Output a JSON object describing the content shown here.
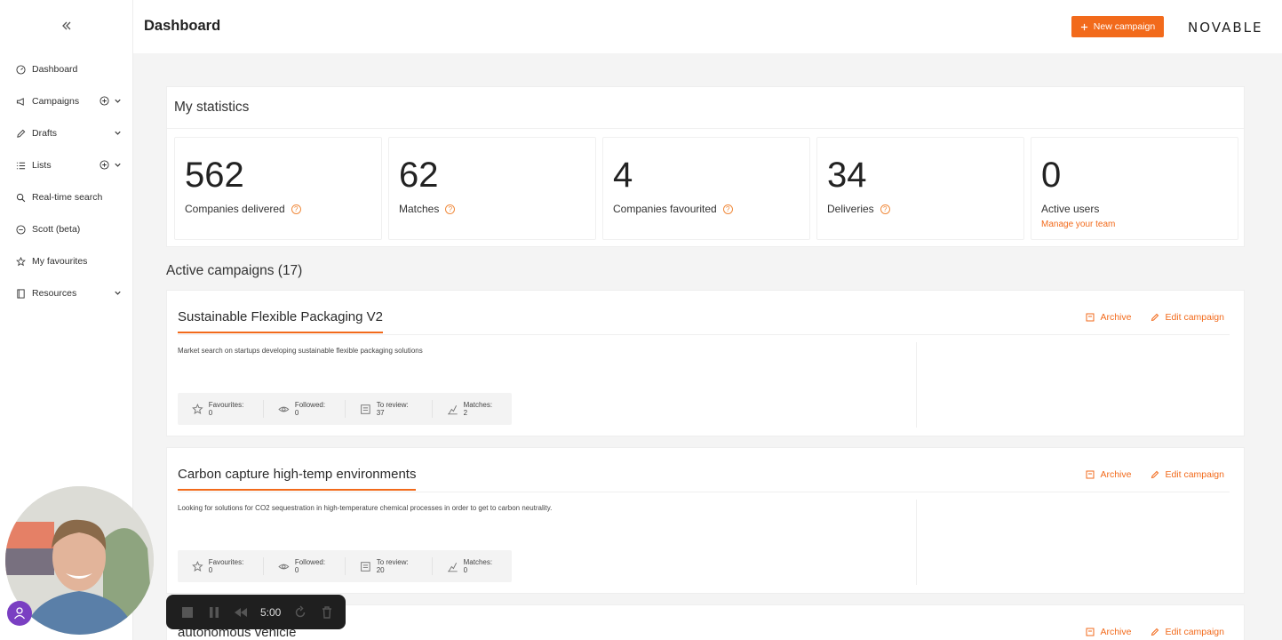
{
  "sidebar": {
    "items": [
      {
        "label": "Dashboard",
        "icon": "gauge-icon"
      },
      {
        "label": "Campaigns",
        "icon": "megaphone-icon"
      },
      {
        "label": "Drafts",
        "icon": "pencil-icon"
      },
      {
        "label": "Lists",
        "icon": "list-icon"
      },
      {
        "label": "Real-time search",
        "icon": "search-icon"
      },
      {
        "label": "Scott (beta)",
        "icon": "chat-icon"
      },
      {
        "label": "My favourites",
        "icon": "star-icon"
      },
      {
        "label": "Resources",
        "icon": "book-icon"
      }
    ]
  },
  "header": {
    "title": "Dashboard",
    "new_campaign_label": "New campaign",
    "logo": "NOVABLE"
  },
  "stats": {
    "title": "My statistics",
    "items": [
      {
        "value": "562",
        "label": "Companies delivered"
      },
      {
        "value": "62",
        "label": "Matches"
      },
      {
        "value": "4",
        "label": "Companies favourited"
      },
      {
        "value": "34",
        "label": "Deliveries"
      },
      {
        "value": "0",
        "label": "Active users",
        "link": "Manage your team"
      }
    ]
  },
  "campaigns": {
    "title": "Active campaigns (17)",
    "archive_label": "Archive",
    "edit_label": "Edit campaign",
    "items": [
      {
        "title": "Sustainable Flexible Packaging V2",
        "description": "Market search on startups developing sustainable flexible packaging solutions",
        "favourites": "Favourites: 0",
        "followed": "Followed: 0",
        "to_review": "To review: 37",
        "matches": "Matches: 2"
      },
      {
        "title": "Carbon capture high-temp environments",
        "description": "Looking for solutions for CO2 sequestration in high-temperature chemical processes in order to get to carbon neutrality.",
        "favourites": "Favourites: 0",
        "followed": "Followed: 0",
        "to_review": "To review: 20",
        "matches": "Matches: 0"
      },
      {
        "title": "autonomous vehicle"
      }
    ]
  },
  "recorder": {
    "timer": "5:00"
  },
  "colors": {
    "accent": "#f26a1b",
    "recorder_bg": "#1f1f1f",
    "avatar_purple": "#7a3fc2"
  }
}
